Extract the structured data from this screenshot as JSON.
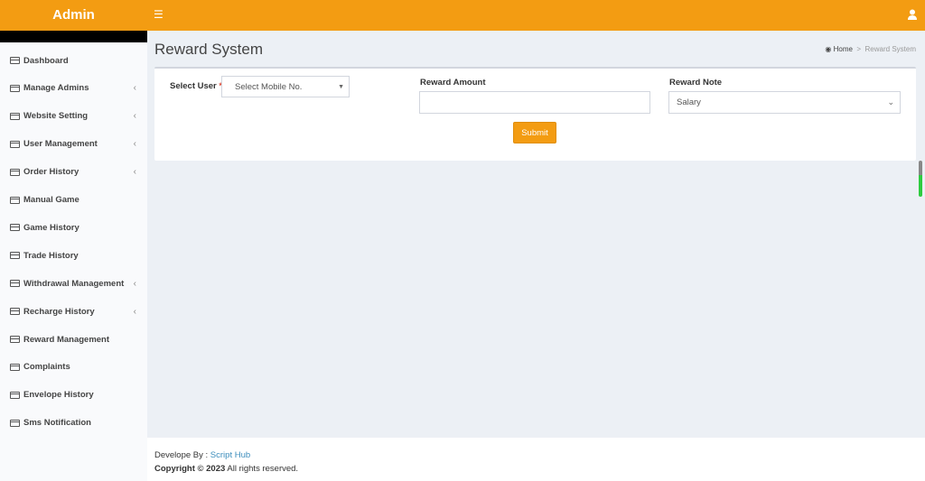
{
  "header": {
    "brand": "Admin",
    "menu_icon": "bars-icon",
    "user_icon": "user-icon"
  },
  "sidebar": {
    "items": [
      {
        "label": "Dashboard",
        "has_submenu": false
      },
      {
        "label": "Manage Admins",
        "has_submenu": true
      },
      {
        "label": "Website Setting",
        "has_submenu": true
      },
      {
        "label": "User Management",
        "has_submenu": true
      },
      {
        "label": "Order History",
        "has_submenu": true
      },
      {
        "label": "Manual Game",
        "has_submenu": false
      },
      {
        "label": "Game History",
        "has_submenu": false
      },
      {
        "label": "Trade History",
        "has_submenu": false
      },
      {
        "label": "Withdrawal Management",
        "has_submenu": true
      },
      {
        "label": "Recharge History",
        "has_submenu": true
      },
      {
        "label": "Reward Management",
        "has_submenu": false
      },
      {
        "label": "Complaints",
        "has_submenu": false
      },
      {
        "label": "Envelope History",
        "has_submenu": false
      },
      {
        "label": "Sms Notification",
        "has_submenu": false
      }
    ]
  },
  "page": {
    "title": "Reward System",
    "breadcrumb": {
      "home": "Home",
      "sep": ">",
      "current": "Reward System"
    }
  },
  "form": {
    "select_user_label": "Select User",
    "required_mark": "*",
    "select_user_placeholder": "Select Mobile No.",
    "reward_amount_label": "Reward Amount",
    "reward_amount_value": "",
    "reward_note_label": "Reward Note",
    "reward_note_value": "Salary",
    "submit_label": "Submit"
  },
  "footer": {
    "developed_by": "Develope By : ",
    "developer": "Script Hub",
    "copyright": "Copyright © 2023",
    "rights": " All rights reserved."
  },
  "colors": {
    "accent": "#f39c12",
    "link": "#3c8dbc"
  }
}
